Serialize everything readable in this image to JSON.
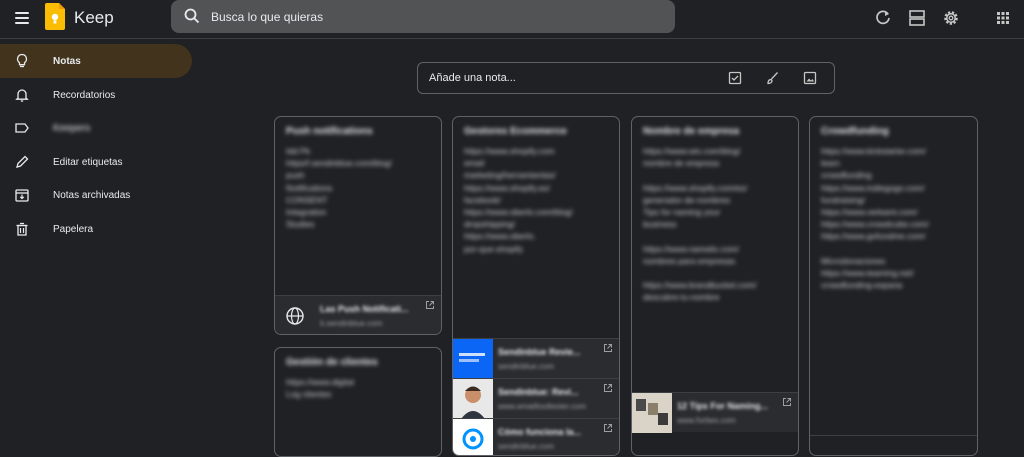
{
  "app": {
    "title": "Keep"
  },
  "search": {
    "placeholder": "Busca lo que quieras"
  },
  "toolbar": {
    "icons": [
      "refresh-icon",
      "list-view-icon",
      "settings-icon",
      "apps-icon"
    ]
  },
  "sidebar": {
    "items": [
      {
        "label": "Notas",
        "icon": "lightbulb-icon",
        "active": true
      },
      {
        "label": "Recordatorios",
        "icon": "bell-icon"
      },
      {
        "label": "Keepers",
        "icon": "label-icon"
      },
      {
        "label": "Editar etiquetas",
        "icon": "pencil-icon"
      },
      {
        "label": "Notas archivadas",
        "icon": "archive-icon"
      },
      {
        "label": "Papelera",
        "icon": "trash-icon"
      }
    ]
  },
  "take_note": {
    "placeholder": "Añade una nota...",
    "icons": [
      "checkbox-icon",
      "brush-icon",
      "image-icon"
    ]
  },
  "notes": [
    {
      "title": "Push notifications",
      "body": "Idd Pk\nhttps/f.sendinblue.com/blog/\npush\nNotifications\nCONSENT\nIntegration\nStudies",
      "links": [
        {
          "title": "Las Push Notificati...",
          "domain": "ti.sendinblue.com"
        }
      ]
    },
    {
      "title": "Gestión de clientes",
      "body": "https://www.digital\nLog clientes",
      "links": []
    },
    {
      "title": "Gestores Ecommerce",
      "body": "https://www.shopify.com\nemail\nmarketing/herramientas/\nhttps://www.shopify.es/\nfacebook/\nhttps://www.oberlo.com/blog/\ndropshipping/\nhttps://www.oberlo.\npor-que-shopify",
      "links": [
        {
          "title": "Sendinblue Revie...",
          "domain": "sendinblue.com"
        },
        {
          "title": "Sendinblue: Revi...",
          "domain": "www.emailtooltester.com"
        },
        {
          "title": "Cómo funciona la...",
          "domain": "sendinblue.com"
        }
      ]
    },
    {
      "title": "Nombre de empresa",
      "body": "https://www.wix.com/blog/\nnombre de empresa\n\nhttps://www.shopify.com/es/\ngenerador-de-nombres\nTips for naming your\nbusiness\n\nhttps://www.namelix.com/\nnombres para empresas\n\nhttps://www.brandbucket.com/\ndescubre-tu-nombre",
      "links": [
        {
          "title": "12 Tips For Naming...",
          "domain": "www.forbes.com"
        }
      ]
    },
    {
      "title": "Crowdfunding",
      "body": "https://www.kickstarter.com/\nlearn\ncrowdfunding\nhttps://www.indiegogo.com/\nfundraising/\nhttps://www.verkami.com/\nhttps://www.crowdcube.com/\nhttps://www.gofundme.com/\n\nMicrodonaciones\nhttps://www.teaming.net/\ncrowdfunding-espana",
      "links": []
    }
  ]
}
